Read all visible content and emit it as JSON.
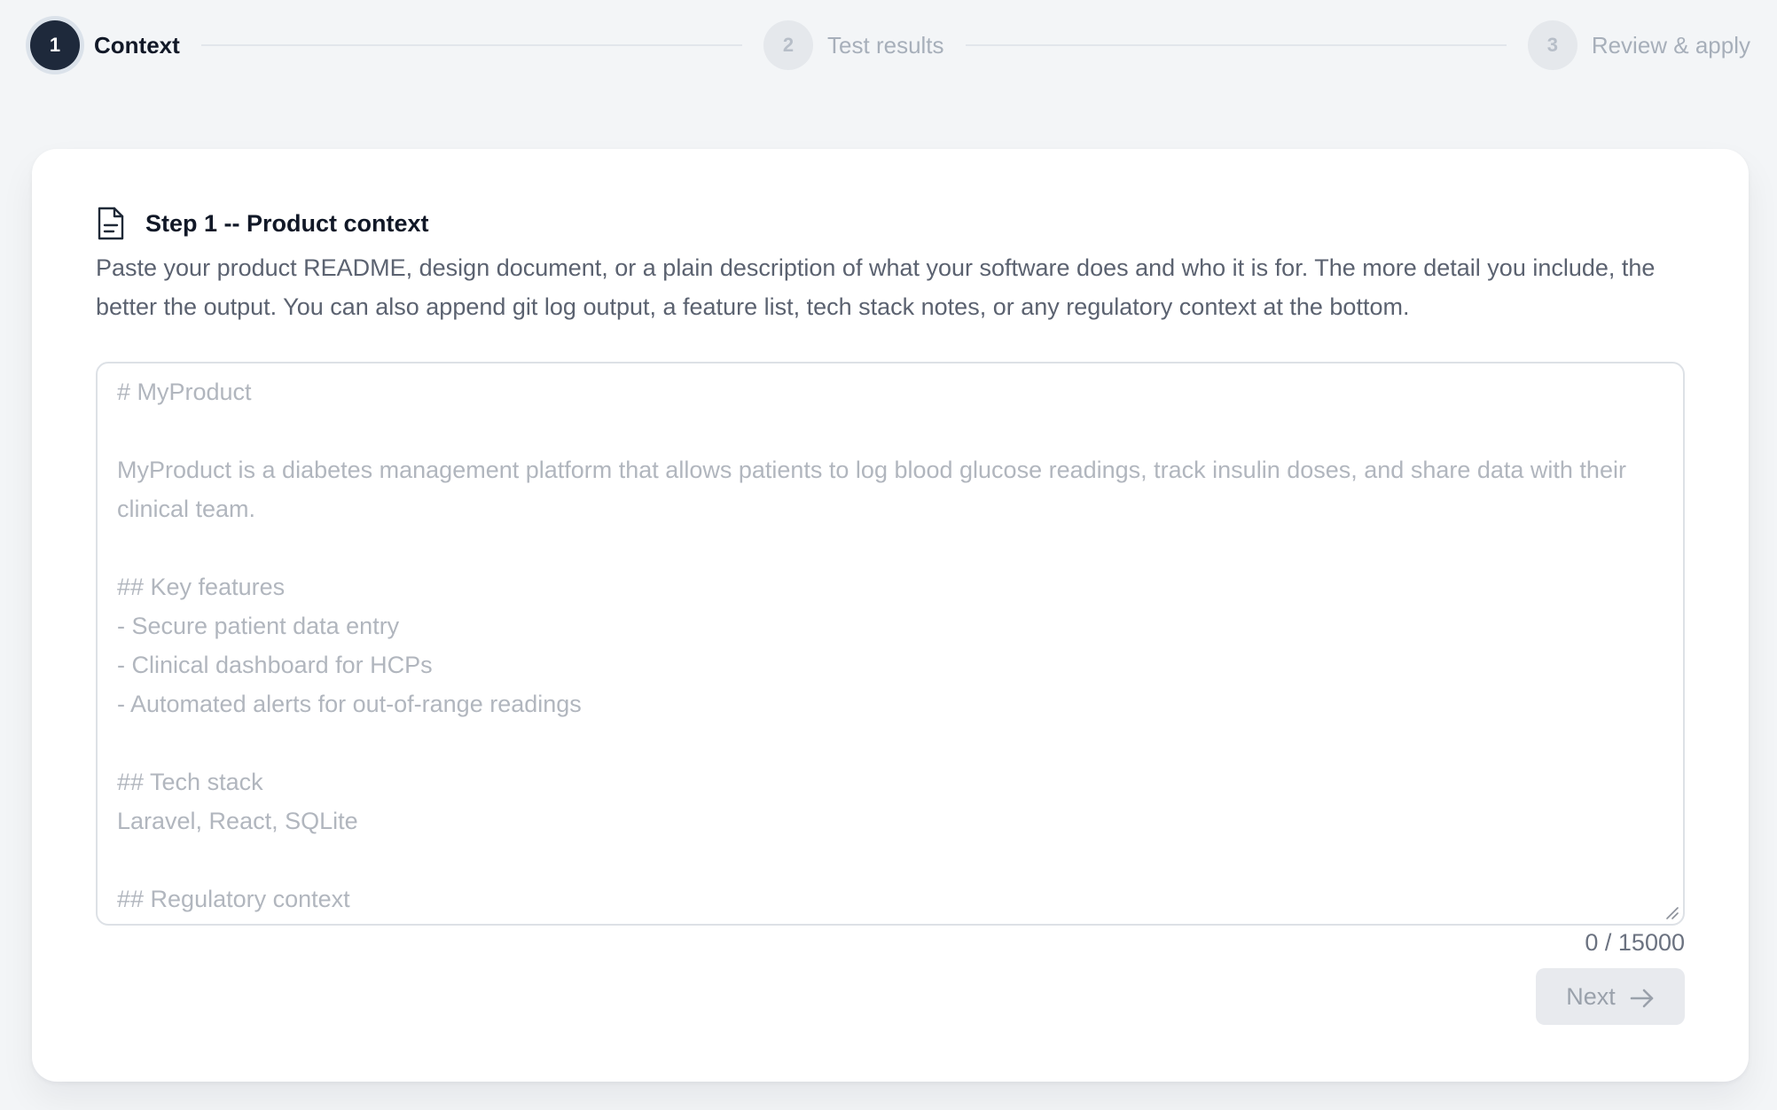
{
  "stepper": {
    "steps": [
      {
        "number": "1",
        "label": "Context",
        "state": "active"
      },
      {
        "number": "2",
        "label": "Test results",
        "state": "inactive"
      },
      {
        "number": "3",
        "label": "Review & apply",
        "state": "inactive"
      }
    ]
  },
  "card": {
    "icon": "document-icon",
    "title": "Step 1 -- Product context",
    "description": "Paste your product README, design document, or a plain description of what your software does and who it is for. The more detail you include, the better the output. You can also append git log output, a feature list, tech stack notes, or any regulatory context at the bottom.",
    "editor": {
      "value": "",
      "placeholder": "# MyProduct\n\nMyProduct is a diabetes management platform that allows patients to log blood glucose readings, track insulin doses, and share data with their clinical team.\n\n## Key features\n- Secure patient data entry\n- Clinical dashboard for HCPs\n- Automated alerts for out-of-range readings\n\n## Tech stack\nLaravel, React, SQLite\n\n## Regulatory context"
    },
    "char_count": "0 / 15000",
    "next_label": "Next",
    "next_icon": "arrow-right-icon"
  },
  "colors": {
    "background": "#f3f5f7",
    "active_step": "#1e293b",
    "inactive_step": "#e5e8ec",
    "button_disabled": "#e8eaee"
  }
}
